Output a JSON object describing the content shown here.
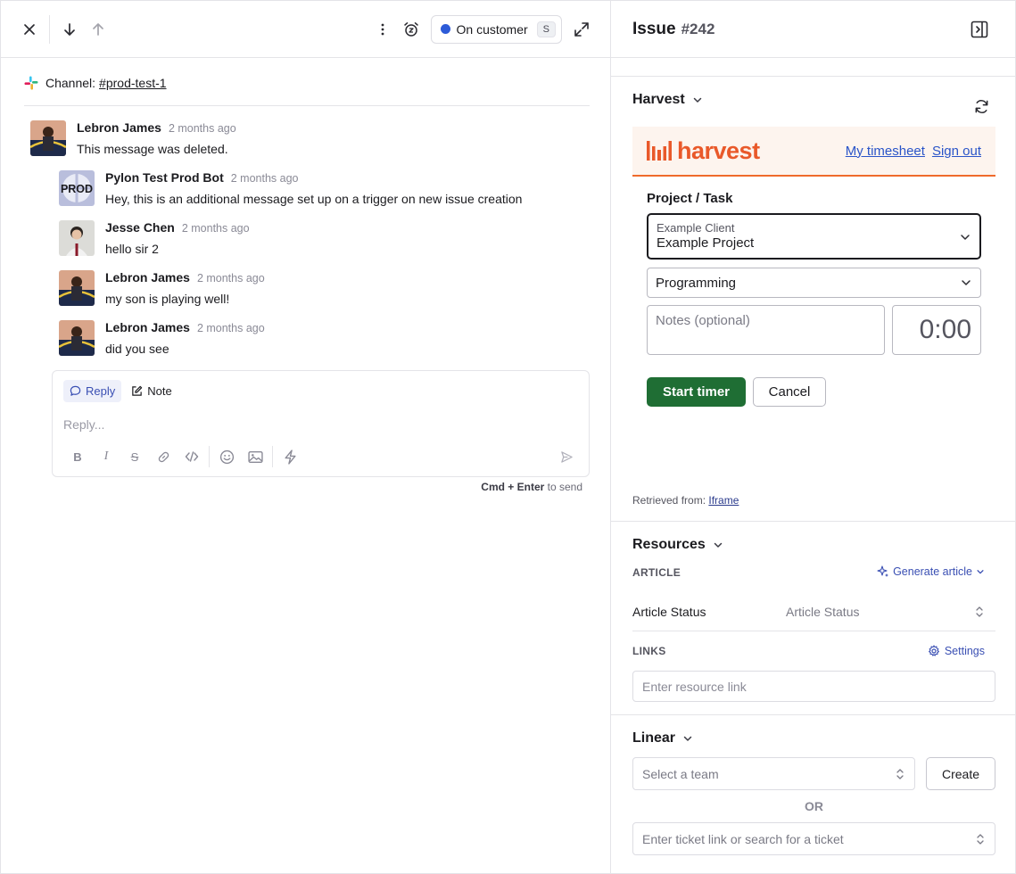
{
  "topbar": {
    "status_label": "On customer",
    "status_shortcut": "S",
    "status_color": "#2d5bd8"
  },
  "channel": {
    "label": "Channel:",
    "name": "#prod-test-1"
  },
  "messages": [
    {
      "author": "Lebron James",
      "time": "2 months ago",
      "body": "This message was deleted."
    },
    {
      "author": "Pylon Test Prod Bot",
      "time": "2 months ago",
      "body": "Hey, this is an additional message set up on a trigger on new issue creation",
      "avatar_text": "PROD"
    },
    {
      "author": "Jesse Chen",
      "time": "2 months ago",
      "body": "hello sir 2"
    },
    {
      "author": "Lebron James",
      "time": "2 months ago",
      "body": "my son is playing well!"
    },
    {
      "author": "Lebron James",
      "time": "2 months ago",
      "body": "did you see"
    }
  ],
  "composer": {
    "tab_reply": "Reply",
    "tab_note": "Note",
    "placeholder": "Reply...",
    "hint_keys": "Cmd + Enter",
    "hint_text": " to send"
  },
  "issue": {
    "title": "Issue",
    "number": "#242"
  },
  "harvest": {
    "section_title": "Harvest",
    "logo_text": "harvest",
    "link_timesheet": "My timesheet",
    "link_signout": "Sign out",
    "project_task_label": "Project / Task",
    "client": "Example Client",
    "project": "Example Project",
    "task": "Programming",
    "notes_placeholder": "Notes (optional)",
    "timer": "0:00",
    "start_label": "Start timer",
    "cancel_label": "Cancel",
    "retrieved_label": "Retrieved from:",
    "retrieved_link": "Iframe",
    "brand_color": "#e9592a",
    "start_color": "#1f6e34"
  },
  "resources": {
    "section_title": "Resources",
    "article_label": "ARTICLE",
    "generate_label": "Generate article",
    "article_status_label": "Article Status",
    "article_status_value": "Article Status",
    "links_label": "LINKS",
    "settings_label": "Settings",
    "link_placeholder": "Enter resource link"
  },
  "linear": {
    "section_title": "Linear",
    "team_placeholder": "Select a team",
    "create_label": "Create",
    "or_label": "OR",
    "ticket_placeholder": "Enter ticket link or search for a ticket"
  }
}
